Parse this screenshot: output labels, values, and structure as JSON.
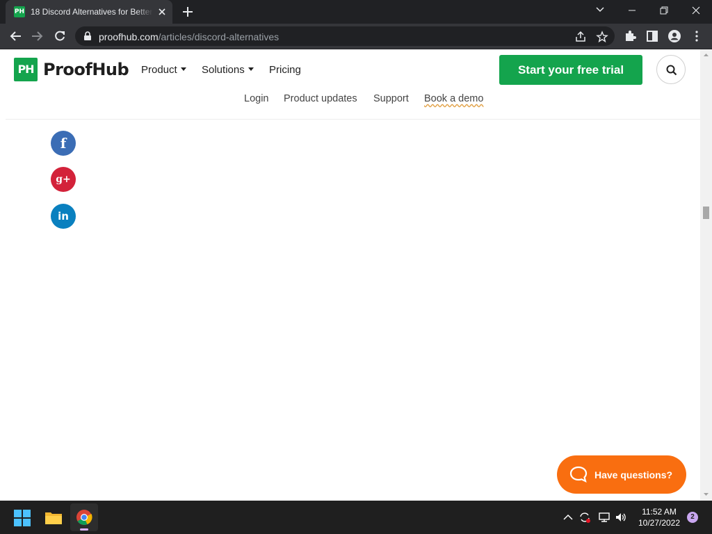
{
  "browser": {
    "tab": {
      "favicon_text": "PH",
      "title": "18 Discord Alternatives for Better"
    },
    "url_host": "proofhub.com",
    "url_path": "/articles/discord-alternatives"
  },
  "site": {
    "logo_mark": "PH",
    "logo_text": "ProofHub",
    "brand_color": "#14a44d",
    "nav": {
      "product": "Product",
      "solutions": "Solutions",
      "pricing": "Pricing"
    },
    "cta_label": "Start your free trial",
    "subnav": {
      "login": "Login",
      "updates": "Product updates",
      "support": "Support",
      "demo": "Book a demo"
    },
    "social": {
      "facebook": "f",
      "google_plus": "g+",
      "linkedin": "in"
    },
    "chat_label": "Have questions?",
    "chat_color": "#f96e10"
  },
  "taskbar": {
    "time": "11:52 AM",
    "date": "10/27/2022",
    "notification_count": "2"
  }
}
